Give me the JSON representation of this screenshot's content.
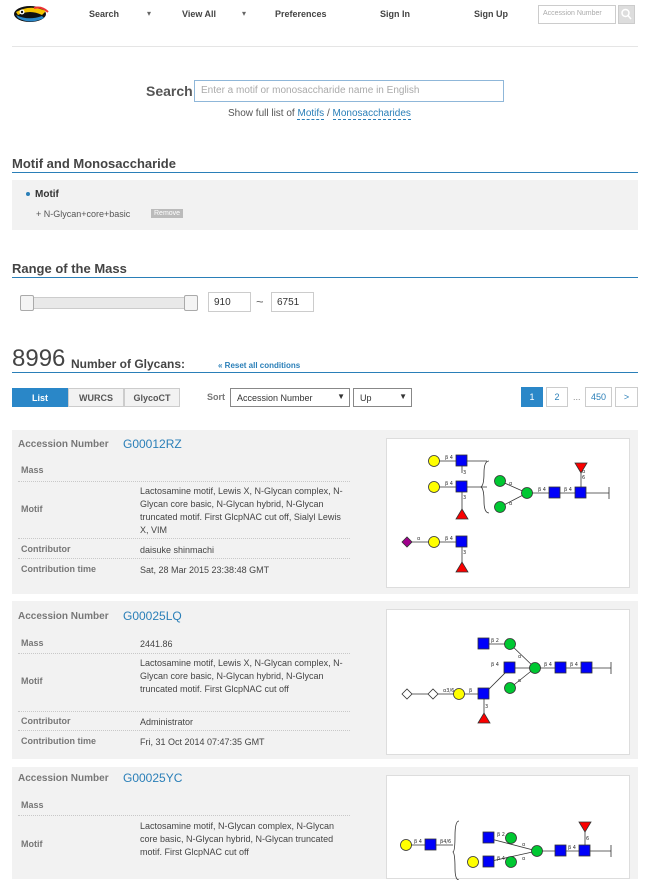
{
  "nav": {
    "items": [
      "Search",
      "View All",
      "Preferences",
      "Sign In",
      "Sign Up"
    ],
    "accession_placeholder": "Accession Number"
  },
  "search": {
    "label": "Search",
    "placeholder": "Enter a motif or monosaccharide name in English",
    "show_full_prefix": "Show full list of",
    "motifs_link": "Motifs",
    "separator": "/",
    "monosaccharides_link": "Monosaccharides"
  },
  "motif_section": {
    "title": "Motif and Monosaccharide",
    "heading": "Motif",
    "item": "N-Glycan+core+basic",
    "remove": "Remove"
  },
  "mass_section": {
    "title": "Range of the Mass",
    "min": "910",
    "max": "6751",
    "tilde": "~"
  },
  "results": {
    "count": "8996",
    "count_label": "Number of Glycans:",
    "reset": "« Reset all conditions"
  },
  "toolbar": {
    "tabs": [
      "List",
      "WURCS",
      "GlycoCT"
    ],
    "sort_label": "Sort",
    "sort_field": "Accession Number",
    "sort_order": "Up",
    "pages": [
      "1",
      "2",
      "450",
      ">"
    ],
    "ellipsis": "..."
  },
  "glycans": [
    {
      "acc_label": "Accession Number",
      "accession": "G00012RZ",
      "rows": [
        {
          "label": "Mass",
          "value": ""
        },
        {
          "label": "Motif",
          "value": "Lactosamine motif, Lewis X, N-Glycan complex, N-Glycan core basic, N-Glycan hybrid, N-Glycan truncated motif. First GlcpNAC cut off, Sialyl Lewis X, VIM"
        },
        {
          "label": "Contributor",
          "value": "daisuke shinmachi"
        },
        {
          "label": "Contribution time",
          "value": "Sat, 28 Mar 2015 23:38:48 GMT"
        }
      ]
    },
    {
      "acc_label": "Accession Number",
      "accession": "G00025LQ",
      "rows": [
        {
          "label": "Mass",
          "value": "2441.86"
        },
        {
          "label": "Motif",
          "value": "Lactosamine motif, Lewis X, N-Glycan complex, N-Glycan core basic, N-Glycan hybrid, N-Glycan truncated motif. First GlcpNAC cut off"
        },
        {
          "label": "Contributor",
          "value": "Administrator"
        },
        {
          "label": "Contribution time",
          "value": "Fri, 31 Oct 2014 07:47:35 GMT"
        }
      ]
    },
    {
      "acc_label": "Accession Number",
      "accession": "G00025YC",
      "rows": [
        {
          "label": "Mass",
          "value": ""
        },
        {
          "label": "Motif",
          "value": "Lactosamine motif, N-Glycan complex, N-Glycan core basic, N-Glycan hybrid, N-Glycan truncated motif. First GlcpNAC cut off"
        }
      ]
    }
  ],
  "colors": {
    "accent": "#2a87c8",
    "link": "#2a7fb8",
    "galactose": "#ffff00",
    "glcnac": "#0000fa",
    "mannose": "#00c832",
    "fucose": "#fa0000",
    "sialic": "#a0008c"
  }
}
